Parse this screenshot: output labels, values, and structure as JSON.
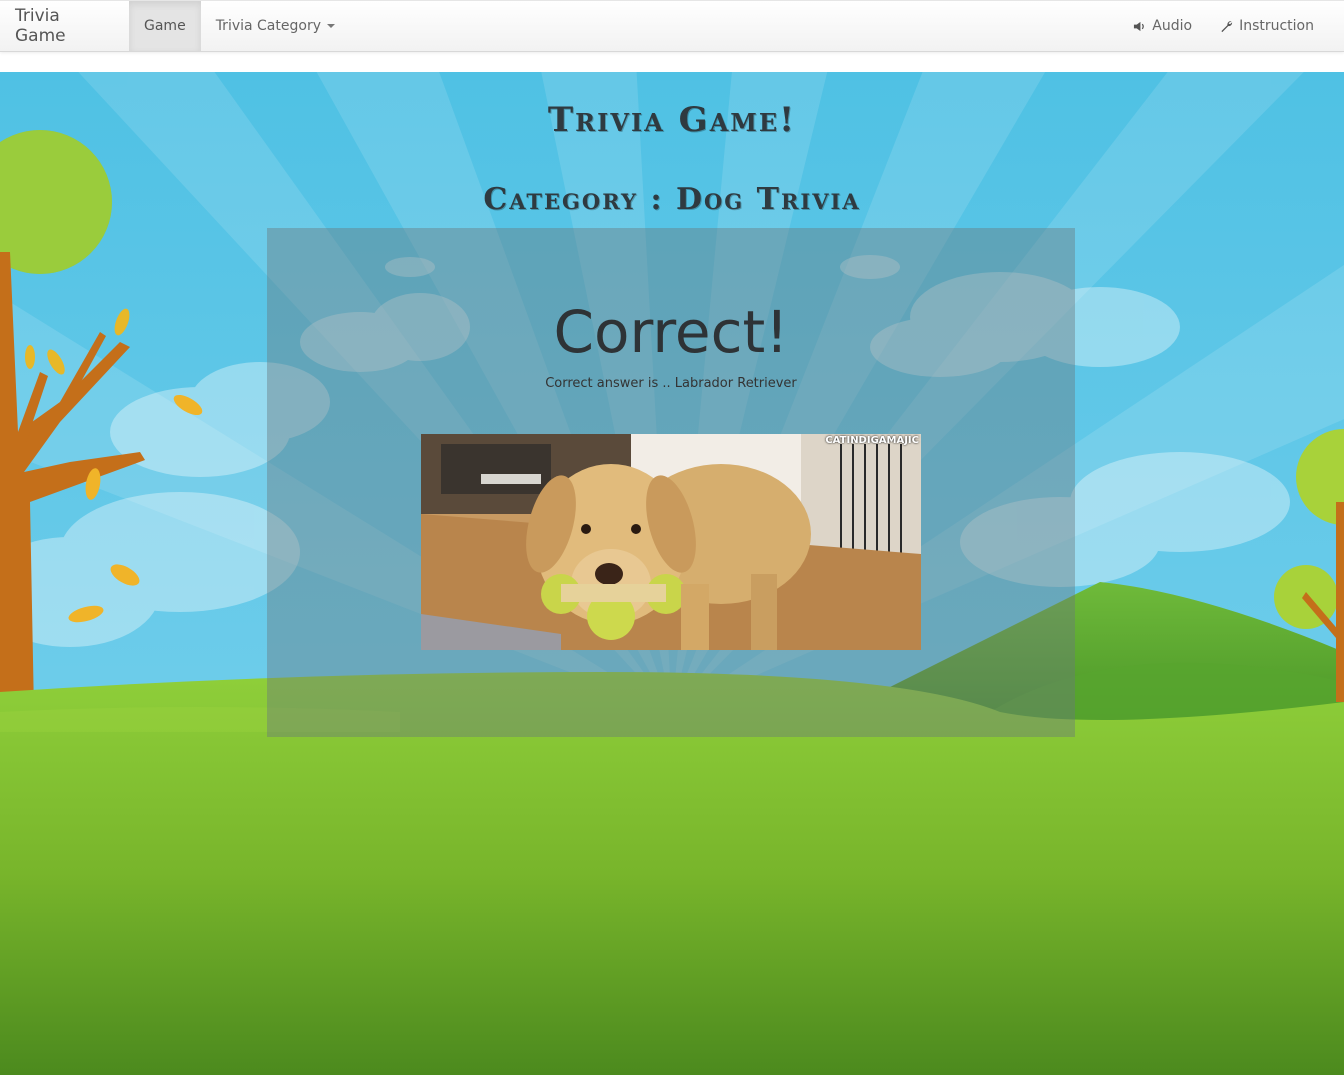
{
  "navbar": {
    "brand": "Trivia Game",
    "items": [
      {
        "label": "Game",
        "active": true
      },
      {
        "label": "Trivia Category",
        "dropdown": true
      }
    ],
    "right_items": [
      {
        "label": "Audio",
        "icon": "speaker-icon"
      },
      {
        "label": "Instruction",
        "icon": "wrench-icon"
      }
    ]
  },
  "game": {
    "title": "Trivia Game!",
    "category_line": "Category : Dog Trivia",
    "result_heading": "Correct!",
    "answer_text": "Correct answer is .. Labrador Retriever",
    "image_watermark": "CATINDIGAMAJIC"
  },
  "colors": {
    "sky": "#56c7e6",
    "grass": "#7fbf2e",
    "panel_overlay": "rgba(105,120,125,0.42)",
    "title_text": "#2f3a40"
  }
}
